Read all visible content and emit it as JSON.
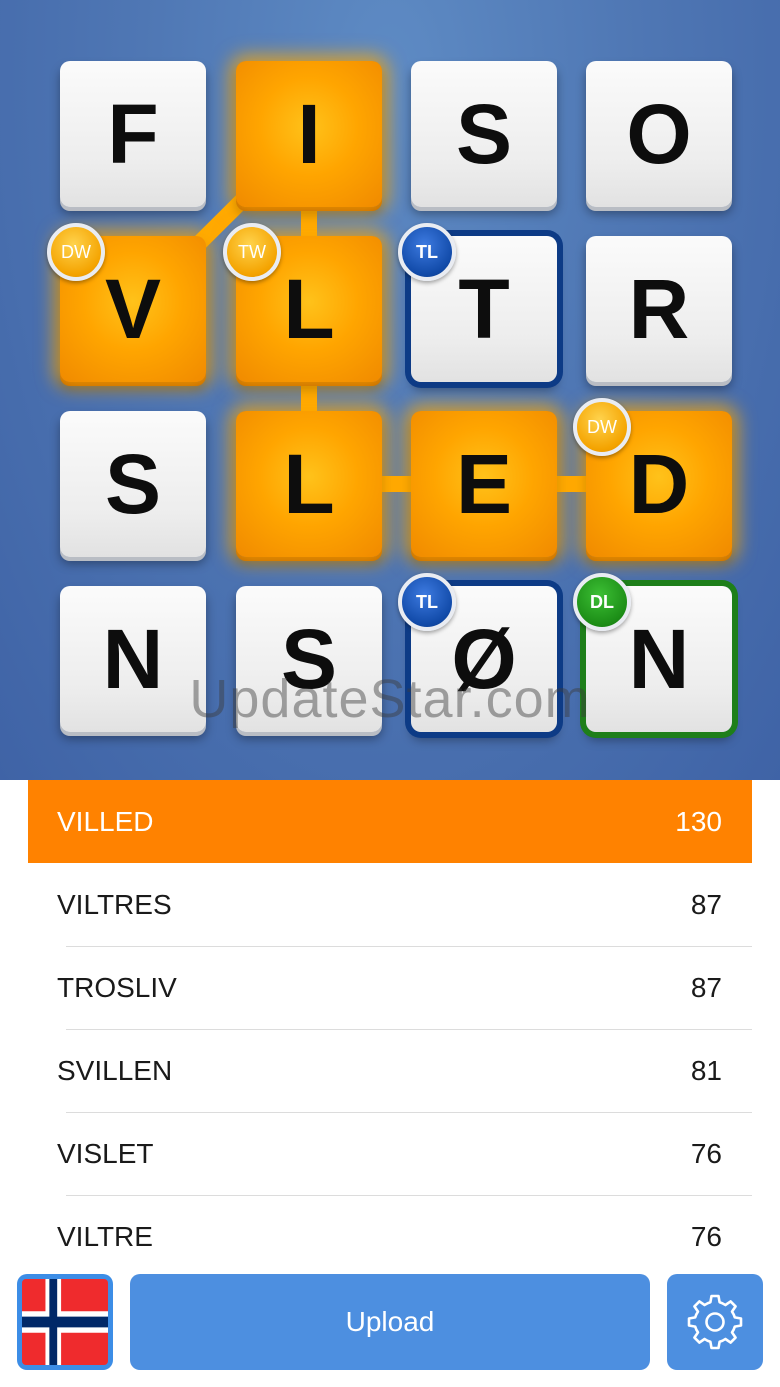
{
  "board": {
    "tiles": [
      {
        "letter": "F",
        "selected": false
      },
      {
        "letter": "I",
        "selected": true
      },
      {
        "letter": "S",
        "selected": false
      },
      {
        "letter": "O",
        "selected": false
      },
      {
        "letter": "V",
        "selected": true,
        "badge": "DW"
      },
      {
        "letter": "L",
        "selected": true,
        "badge": "TW"
      },
      {
        "letter": "T",
        "selected": false,
        "badge": "TL"
      },
      {
        "letter": "R",
        "selected": false
      },
      {
        "letter": "S",
        "selected": false
      },
      {
        "letter": "L",
        "selected": true
      },
      {
        "letter": "E",
        "selected": true
      },
      {
        "letter": "D",
        "selected": true,
        "badge": "DW"
      },
      {
        "letter": "N",
        "selected": false
      },
      {
        "letter": "S",
        "selected": false
      },
      {
        "letter": "Ø",
        "selected": false,
        "badge": "TL"
      },
      {
        "letter": "N",
        "selected": false,
        "badge": "DL"
      }
    ],
    "path_tile_order": [
      4,
      1,
      5,
      9,
      10,
      11
    ],
    "colors": {
      "selected": "#ff9f00",
      "path": "#ffaa00",
      "tl_border": "#0d3b86",
      "dl_border": "#1e7f1a"
    }
  },
  "watermark": "UpdateStar.com",
  "words": [
    {
      "word": "VILLED",
      "score": "130",
      "active": true
    },
    {
      "word": "VILTRES",
      "score": "87",
      "active": false
    },
    {
      "word": "TROSLIV",
      "score": "87",
      "active": false
    },
    {
      "word": "SVILLEN",
      "score": "81",
      "active": false
    },
    {
      "word": "VISLET",
      "score": "76",
      "active": false
    },
    {
      "word": "VILTRE",
      "score": "76",
      "active": false
    }
  ],
  "toolbar": {
    "flag_icon": "norway-flag-icon",
    "upload_label": "Upload",
    "settings_icon": "gear-icon"
  },
  "accent_color": "#ff8200"
}
